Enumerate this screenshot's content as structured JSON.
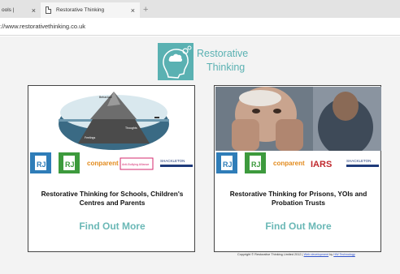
{
  "browser": {
    "prev_tab_label": "ools |",
    "active_tab_label": "Restorative Thinking",
    "close_glyph": "×",
    "new_tab_glyph": "+",
    "url": "://www.restorativethinking.co.uk"
  },
  "logo": {
    "line1": "Restorative",
    "line2": "Thinking",
    "color": "#5ab1b2"
  },
  "cards": [
    {
      "image": "iceberg-illustration",
      "iceberg_labels": [
        "Behaviour",
        "Feelings",
        "Thoughts"
      ],
      "partner_logos": [
        "RJC",
        "RJC",
        "conparent",
        "Anti-Bullying Alliance",
        "SHACKLETON"
      ],
      "title": "Restorative Thinking for Schools, Children's Centres and Parents",
      "link": "Find Out More"
    },
    {
      "image": "distressed-man-photo",
      "partner_logos": [
        "RJC",
        "RJC",
        "conparent",
        "IARS",
        "SHACKLETON"
      ],
      "title": "Restorative Thinking for Prisons, YOIs and Probation Trusts",
      "link": "Find Out More"
    }
  ],
  "footer": {
    "text": "Copyright © Restorative Thinking Limited 2012 | ",
    "link1": "Web development",
    "by": " by ",
    "link2": "HW Technology"
  },
  "colors": {
    "accent": "#6ab8b6",
    "anti_bullying": "#d4286e",
    "iars": "#c0282d",
    "shackleton": "#1e3a7a"
  }
}
